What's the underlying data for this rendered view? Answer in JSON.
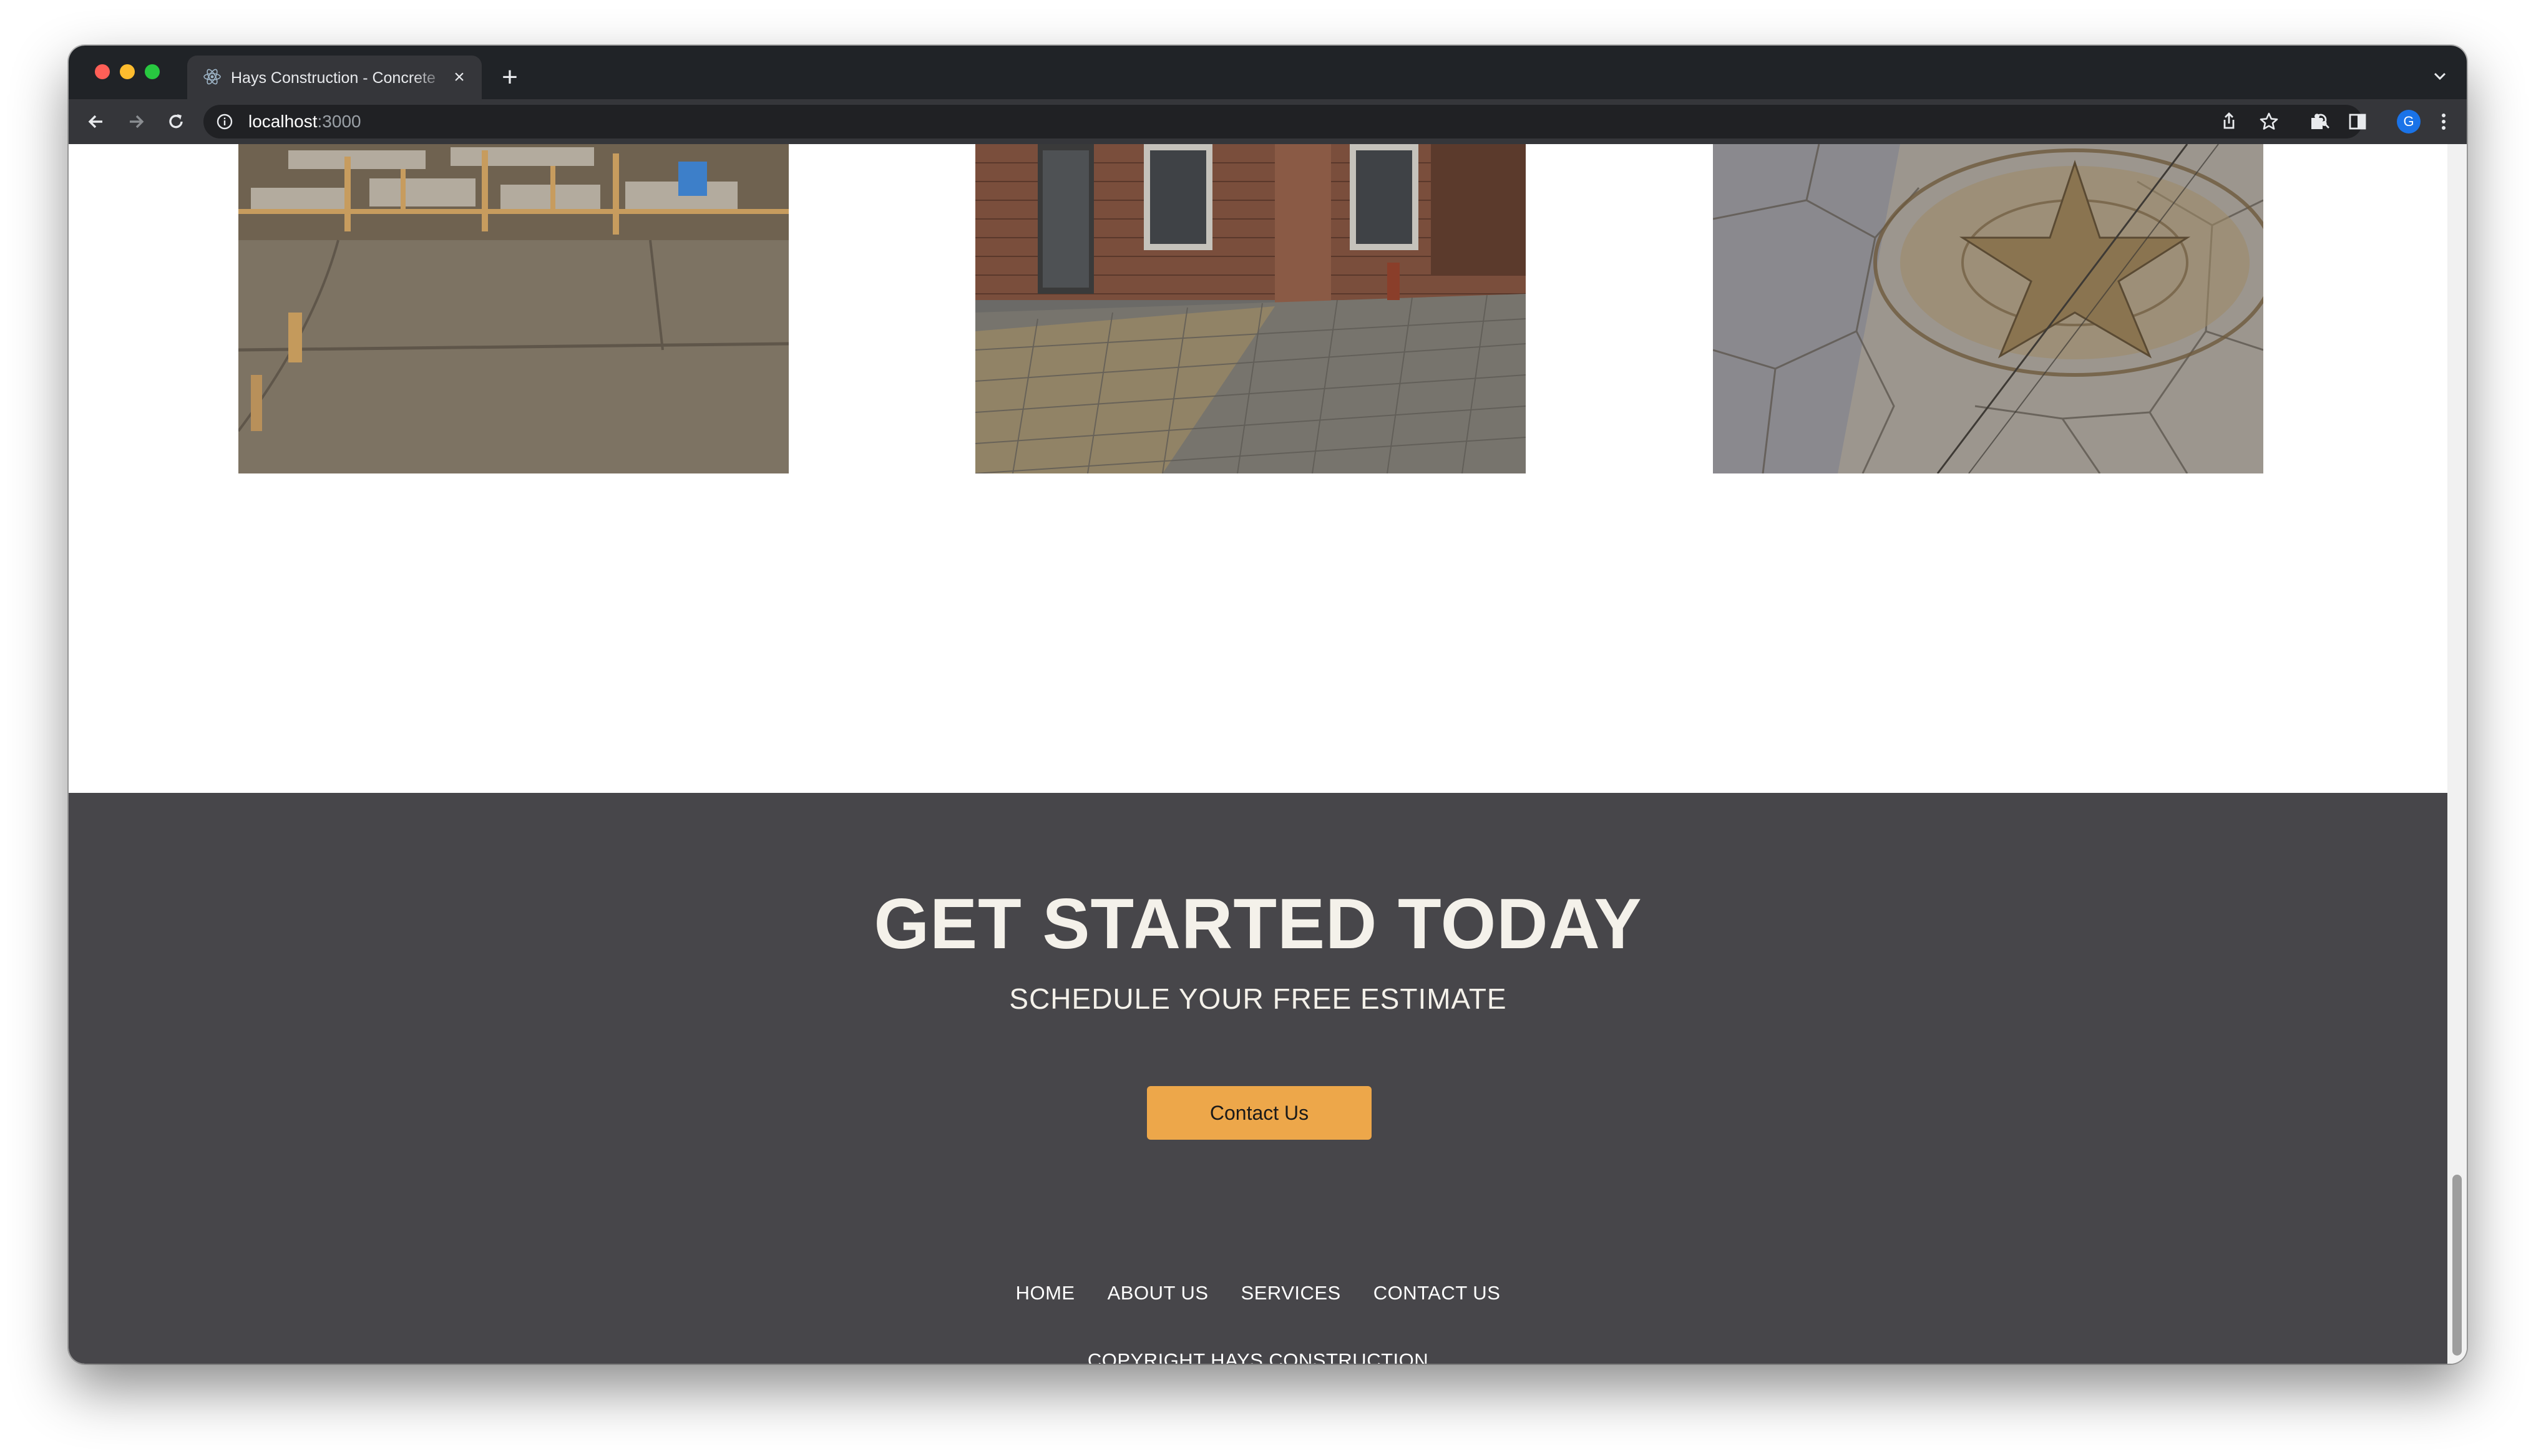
{
  "browser": {
    "tab": {
      "title": "Hays Construction - Concrete",
      "close_icon": "close-icon",
      "favicon": "react-logo-icon"
    },
    "new_tab_icon": "plus-icon",
    "tab_search_icon": "chevron-down-icon",
    "toolbar": {
      "back_icon": "arrow-left-icon",
      "forward_icon": "arrow-right-icon",
      "reload_icon": "reload-icon",
      "site_info_icon": "info-icon",
      "url_host": "localhost",
      "url_port": ":3000",
      "zoom_icon": "magnifier-icon",
      "share_icon": "share-icon",
      "bookmark_icon": "star-icon",
      "extensions_icon": "puzzle-icon",
      "side_panel_icon": "side-panel-icon",
      "profile_initial": "G",
      "menu_icon": "kebab-menu-icon"
    }
  },
  "gallery": {
    "images": [
      {
        "name": "gallery-image-new-concrete-slab",
        "subject": "freshly poured concrete slab with wooden forms"
      },
      {
        "name": "gallery-image-stamped-brick-patio",
        "subject": "stamped herringbone patio beside brick house"
      },
      {
        "name": "gallery-image-stamped-star-medallion",
        "subject": "stamped flagstone concrete with star medallion"
      }
    ]
  },
  "cta": {
    "title": "GET STARTED TODAY",
    "subtitle": "SCHEDULE YOUR FREE ESTIMATE",
    "button_label": "Contact Us"
  },
  "footer": {
    "nav": [
      {
        "label": "HOME"
      },
      {
        "label": "ABOUT US"
      },
      {
        "label": "SERVICES"
      },
      {
        "label": "CONTACT US"
      }
    ],
    "copyright": "COPYRIGHT HAYS CONSTRUCTION"
  },
  "colors": {
    "cta_background": "#47464a",
    "button_accent": "#eda74a",
    "chrome_dark": "#202327",
    "chrome_toolbar": "#35363a"
  }
}
